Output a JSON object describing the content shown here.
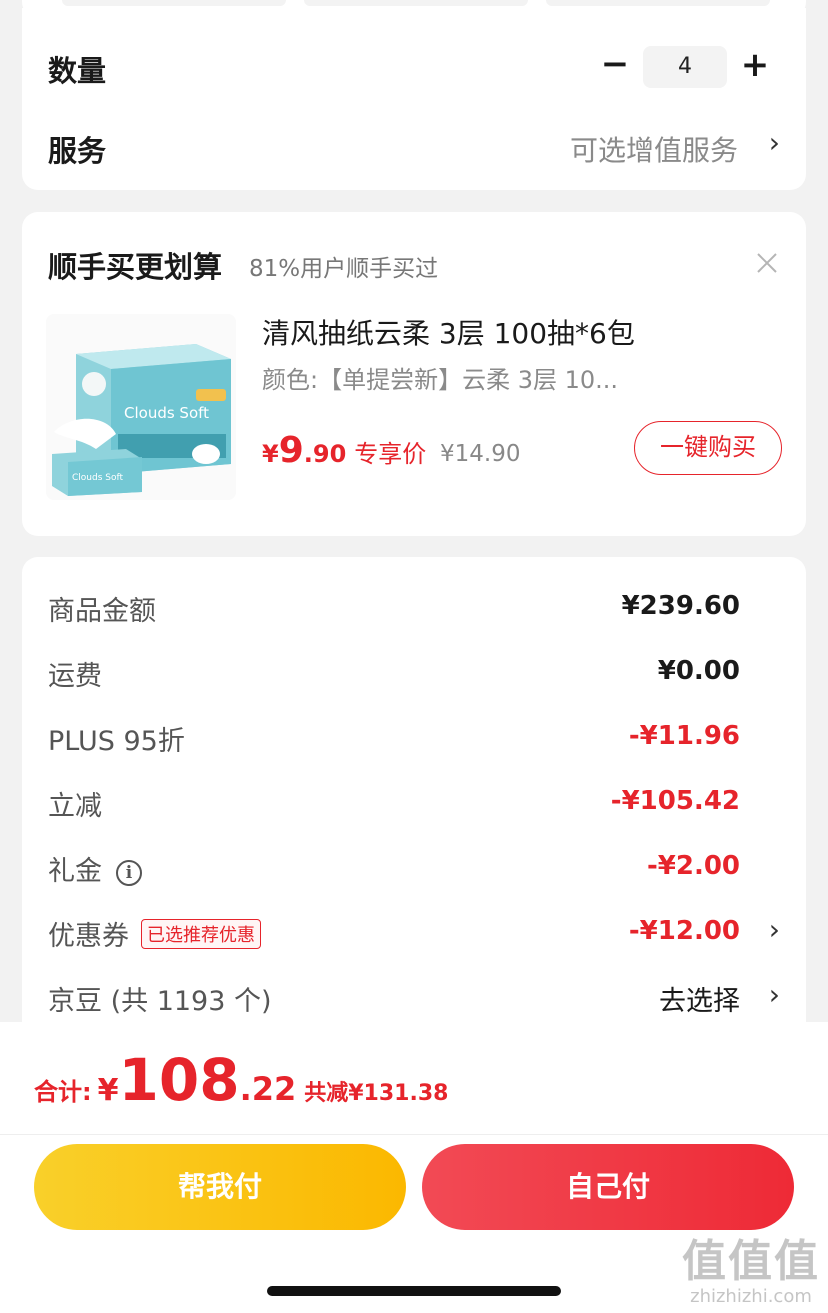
{
  "quantity": {
    "label": "数量",
    "minus": "−",
    "value": "4",
    "plus": "+"
  },
  "service": {
    "label": "服务",
    "value": "可选增值服务",
    "chevron": "›"
  },
  "recommend": {
    "title": "顺手买更划算",
    "subtitle": "81%用户顺手买过",
    "close_icon": "close-icon",
    "product": {
      "name": "清风抽纸云柔 3层 100抽*6包",
      "spec": "颜色:【单提尝新】云柔 3层 10...",
      "image_text": "Clouds Soft",
      "image_text_small": "Clouds Soft",
      "price_symbol": "¥",
      "price_int": "9",
      "price_dec": ".90",
      "price_tag": "专享价",
      "original_price": "¥14.90",
      "buy_label": "一键购买"
    }
  },
  "pricing": {
    "rows": [
      {
        "label": "商品金额",
        "value": "¥239.60"
      },
      {
        "label": "运费",
        "value": "¥0.00"
      },
      {
        "label": "PLUS 95折",
        "value": "-¥11.96"
      },
      {
        "label": "立减",
        "value": "-¥105.42"
      },
      {
        "label": "礼金",
        "value": "-¥2.00",
        "info_icon": "i"
      },
      {
        "label": "优惠券",
        "badge": "已选推荐优惠",
        "value": "-¥12.00"
      },
      {
        "label": "京豆 (共 1193 个)",
        "value": "去选择"
      }
    ],
    "chevron": "›"
  },
  "footer": {
    "total_label": "合计:",
    "total_symbol": "¥",
    "total_int": "108",
    "total_dec": ".22",
    "savings": "共减¥131.38",
    "help_pay": "帮我付",
    "self_pay": "自己付"
  },
  "watermark": {
    "big": "值值值",
    "small": "zhizhizhi.com"
  },
  "colors": {
    "accent_red": "#e6242b",
    "yellow": "#fbc200",
    "background": "#f2f2f2"
  }
}
